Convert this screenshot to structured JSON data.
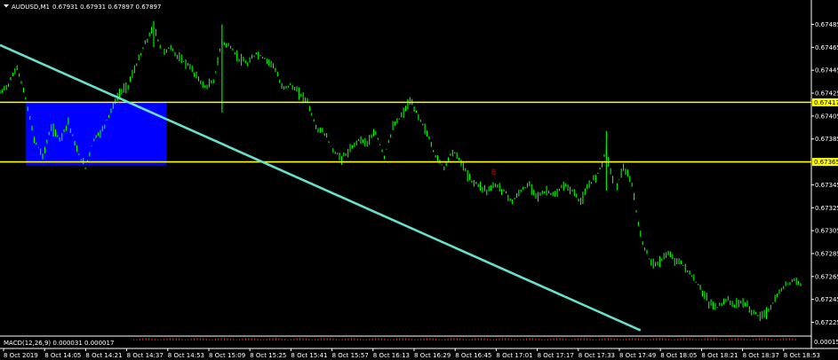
{
  "header": {
    "symbol": "AUDUSD,M1",
    "ohlc": "0.67931 0.67931 0.67897 0.67897"
  },
  "macd_label": "MACD(12,26,9) 0.000031 0.000017",
  "macd_scale_label": "0.000156",
  "colors": {
    "background": "#000000",
    "bars": "#00ff00",
    "trendline": "#66e0cc",
    "hline": "#ffff00",
    "rectangle": "#0000ff",
    "axis_text": "#ffffff",
    "marker": "#cc0000"
  },
  "chart_data": {
    "type": "line",
    "title": "AUDUSD,M1",
    "ylim": [
      0.67213,
      0.67497
    ],
    "y_ticks": [
      "0.67485",
      "0.67465",
      "0.67445",
      "0.67425",
      "0.67405",
      "0.67385",
      "0.67345",
      "0.67325",
      "0.67305",
      "0.67285",
      "0.67265",
      "0.67245",
      "0.67225"
    ],
    "x_ticks": [
      "8 Oct 2019",
      "8 Oct 14:05",
      "8 Oct 14:21",
      "8 Oct 14:37",
      "8 Oct 14:53",
      "8 Oct 15:09",
      "8 Oct 15:25",
      "8 Oct 15:41",
      "8 Oct 15:57",
      "8 Oct 16:13",
      "8 Oct 16:29",
      "8 Oct 16:45",
      "8 Oct 17:01",
      "8 Oct 17:17",
      "8 Oct 17:33",
      "8 Oct 17:49",
      "8 Oct 18:05",
      "8 Oct 18:21",
      "8 Oct 18:37",
      "8 Oct 18:53"
    ],
    "price_levels": [
      {
        "label": "0.67417",
        "value": 0.67417
      },
      {
        "label": "0.67365",
        "value": 0.67365
      }
    ],
    "price_path": [
      [
        0,
        0.67425
      ],
      [
        1,
        0.67433
      ],
      [
        2,
        0.67448
      ],
      [
        3,
        0.6742
      ],
      [
        4,
        0.67385
      ],
      [
        5,
        0.6737
      ],
      [
        6,
        0.67395
      ],
      [
        7,
        0.67385
      ],
      [
        8,
        0.674
      ],
      [
        9,
        0.67375
      ],
      [
        10,
        0.6736
      ],
      [
        11,
        0.67385
      ],
      [
        12,
        0.67393
      ],
      [
        13,
        0.6741
      ],
      [
        14,
        0.67425
      ],
      [
        15,
        0.67432
      ],
      [
        16,
        0.6745
      ],
      [
        17,
        0.67468
      ],
      [
        18,
        0.67483
      ],
      [
        19,
        0.6746
      ],
      [
        20,
        0.67465
      ],
      [
        21,
        0.67455
      ],
      [
        22,
        0.6745
      ],
      [
        23,
        0.6744
      ],
      [
        24,
        0.6743
      ],
      [
        25,
        0.67435
      ],
      [
        26,
        0.6747
      ],
      [
        27,
        0.67465
      ],
      [
        28,
        0.67455
      ],
      [
        29,
        0.6745
      ],
      [
        30,
        0.6746
      ],
      [
        31,
        0.67455
      ],
      [
        32,
        0.6745
      ],
      [
        33,
        0.6743
      ],
      [
        34,
        0.67432
      ],
      [
        35,
        0.67425
      ],
      [
        36,
        0.67418
      ],
      [
        37,
        0.67395
      ],
      [
        38,
        0.6739
      ],
      [
        39,
        0.67375
      ],
      [
        40,
        0.67368
      ],
      [
        41,
        0.67375
      ],
      [
        42,
        0.67385
      ],
      [
        43,
        0.67382
      ],
      [
        44,
        0.6739
      ],
      [
        45,
        0.6737
      ],
      [
        46,
        0.67395
      ],
      [
        47,
        0.67405
      ],
      [
        48,
        0.67418
      ],
      [
        49,
        0.67405
      ],
      [
        50,
        0.6739
      ],
      [
        51,
        0.6737
      ],
      [
        52,
        0.6736
      ],
      [
        53,
        0.67375
      ],
      [
        54,
        0.67365
      ],
      [
        55,
        0.6735
      ],
      [
        56,
        0.67345
      ],
      [
        57,
        0.6734
      ],
      [
        58,
        0.67345
      ],
      [
        59,
        0.6734
      ],
      [
        60,
        0.6733
      ],
      [
        61,
        0.6734
      ],
      [
        62,
        0.67345
      ],
      [
        63,
        0.67335
      ],
      [
        64,
        0.6734
      ],
      [
        65,
        0.67335
      ],
      [
        66,
        0.67345
      ],
      [
        67,
        0.6734
      ],
      [
        68,
        0.6733
      ],
      [
        69,
        0.67345
      ],
      [
        70,
        0.67355
      ],
      [
        71,
        0.67375
      ],
      [
        72,
        0.6734
      ],
      [
        73,
        0.6736
      ],
      [
        74,
        0.67345
      ],
      [
        75,
        0.673
      ],
      [
        76,
        0.6728
      ],
      [
        77,
        0.67275
      ],
      [
        78,
        0.67285
      ],
      [
        79,
        0.6728
      ],
      [
        80,
        0.67275
      ],
      [
        81,
        0.67265
      ],
      [
        82,
        0.67255
      ],
      [
        83,
        0.67242
      ],
      [
        84,
        0.67238
      ],
      [
        85,
        0.67245
      ],
      [
        86,
        0.6724
      ],
      [
        87,
        0.67243
      ],
      [
        88,
        0.67235
      ],
      [
        89,
        0.6723
      ],
      [
        90,
        0.67235
      ],
      [
        91,
        0.67248
      ],
      [
        92,
        0.67258
      ],
      [
        93,
        0.67262
      ],
      [
        94,
        0.67258
      ]
    ],
    "trendline": {
      "start": [
        0,
        0.67467
      ],
      "end": [
        75,
        0.67218
      ]
    },
    "rectangle": {
      "x0": 3,
      "x1": 19.5,
      "y0": 0.67417,
      "y1": 0.67362
    },
    "marker": {
      "text": "8",
      "x": 57.5,
      "y": 0.67357
    }
  }
}
